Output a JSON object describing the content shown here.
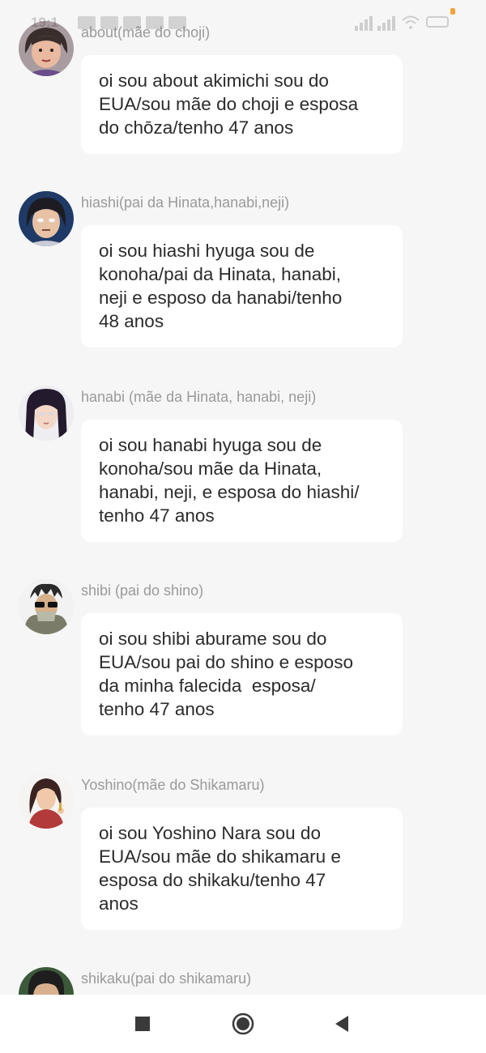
{
  "status_bar": {
    "time": "19:1"
  },
  "messages": [
    {
      "sender": "about(mãe do choji)",
      "avatar": "avatar-about",
      "lines": [
        "oi sou about akimichi sou do",
        "EUA/sou mãe do choji e esposa",
        "do chōza/tenho 47 anos"
      ]
    },
    {
      "sender": "hiashi(pai da Hinata,hanabi,neji)",
      "avatar": "avatar-hiashi",
      "lines": [
        "oi sou hiashi hyuga sou de",
        "konoha/pai da Hinata, hanabi,",
        "neji e esposo da hanabi/tenho",
        "48 anos"
      ]
    },
    {
      "sender": "hanabi (mãe da Hinata, hanabi, neji)",
      "avatar": "avatar-hanabi",
      "lines": [
        "oi sou hanabi hyuga sou de",
        "konoha/sou mãe da Hinata,",
        "hanabi, neji, e esposa do hiashi/",
        "tenho 47 anos"
      ]
    },
    {
      "sender": "shibi (pai do shino)",
      "avatar": "avatar-shibi",
      "lines": [
        "oi sou shibi aburame sou do",
        "EUA/sou pai do shino e esposo",
        "da minha falecida  esposa/",
        "tenho 47 anos"
      ]
    },
    {
      "sender": "Yoshino(mãe do Shikamaru)",
      "avatar": "avatar-yoshino",
      "lines": [
        "oi sou Yoshino Nara sou do",
        "EUA/sou mãe do shikamaru e",
        "esposa do shikaku/tenho 47",
        "anos"
      ]
    },
    {
      "sender": "shikaku(pai do shikamaru)",
      "avatar": "avatar-shikaku",
      "lines": []
    }
  ],
  "navbar": {
    "recents_icon": "square-icon",
    "home_icon": "circle-icon",
    "back_icon": "triangle-back-icon"
  }
}
